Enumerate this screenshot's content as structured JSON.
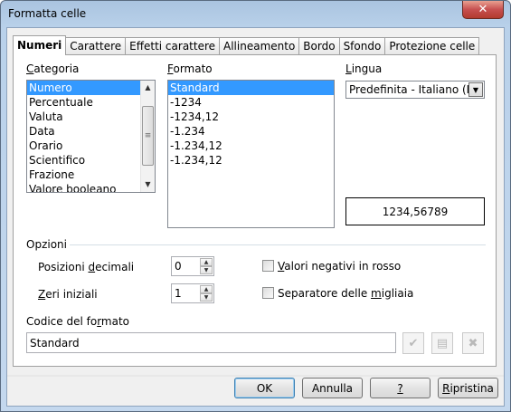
{
  "window": {
    "title": "Formatta celle",
    "close_glyph": "✕"
  },
  "tabs": [
    "Numeri",
    "Carattere",
    "Effetti carattere",
    "Allineamento",
    "Bordo",
    "Sfondo",
    "Protezione celle"
  ],
  "categoria": {
    "label_u": "C",
    "label_rest": "ategoria",
    "items": [
      "Numero",
      "Percentuale",
      "Valuta",
      "Data",
      "Orario",
      "Scientifico",
      "Frazione",
      "Valore booleano"
    ],
    "selected": "Numero"
  },
  "formato": {
    "label_u": "F",
    "label_rest": "ormato",
    "items": [
      "Standard",
      "-1234",
      "-1234,12",
      "-1.234",
      "-1.234,12",
      "-1.234,12"
    ],
    "selected": "Standard"
  },
  "lingua": {
    "label_u": "L",
    "label_rest": "ingua",
    "value": "Predefinita - Italiano (Itali"
  },
  "preview": "1234,56789",
  "opzioni": {
    "heading": "Opzioni",
    "decimali": {
      "label_pre": "Posizioni ",
      "label_u": "d",
      "label_post": "ecimali",
      "value": "0"
    },
    "zeri": {
      "label_u": "Z",
      "label_post": "eri iniziali",
      "value": "1"
    },
    "negativi": {
      "label_u": "V",
      "label_post": "alori negativi in rosso",
      "checked": false
    },
    "migliaia": {
      "label_pre": "Separatore delle ",
      "label_u": "m",
      "label_post": "igliaia",
      "checked": false
    }
  },
  "codice": {
    "label_pre": "Codice del fo",
    "label_u": "r",
    "label_post": "mato",
    "value": "Standard"
  },
  "buttons": {
    "ok": "OK",
    "annulla": "Annulla",
    "help": "?",
    "ripristina_u": "R",
    "ripristina_rest": "ipristina"
  },
  "icons": {
    "accept": "check-icon",
    "comment": "comment-icon",
    "delete": "delete-icon"
  }
}
